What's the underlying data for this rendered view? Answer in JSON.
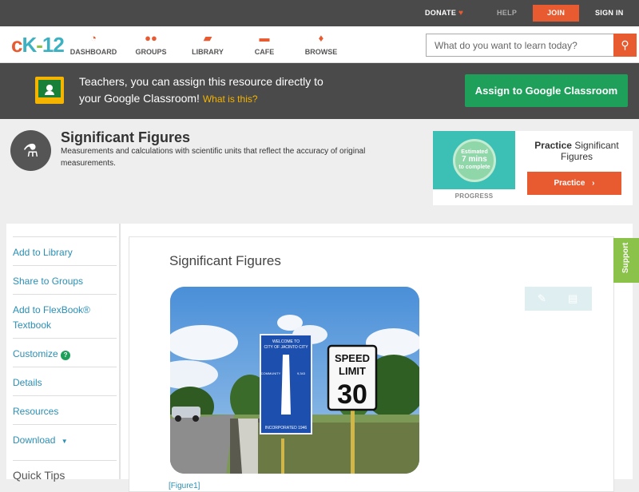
{
  "topbar": {
    "donate": "DONATE",
    "help": "HELP",
    "join": "JOIN",
    "signin": "SIGN IN"
  },
  "logo": {
    "text": "CK-12"
  },
  "nav": [
    {
      "label": "DASHBOARD",
      "icon": "dashboard-icon"
    },
    {
      "label": "GROUPS",
      "icon": "groups-icon"
    },
    {
      "label": "LIBRARY",
      "icon": "library-icon"
    },
    {
      "label": "CAFE",
      "icon": "cafe-icon"
    },
    {
      "label": "BROWSE",
      "icon": "browse-icon"
    }
  ],
  "search": {
    "placeholder": "What do you want to learn today?"
  },
  "classroom": {
    "line1": "Teachers, you can assign this resource directly to",
    "line2": "your Google Classroom!",
    "link": "What is this?",
    "button": "Assign to Google Classroom"
  },
  "concept": {
    "title": "Significant Figures",
    "description": "Measurements and calculations with scientific units that reflect the accuracy of original measurements."
  },
  "practice": {
    "estimate_line1": "Estimated",
    "estimate_line2": "7 mins",
    "estimate_line3": "to complete",
    "progress": "PROGRESS",
    "title_bold": "Practice",
    "title_rest": "Significant Figures",
    "button": "Practice"
  },
  "sidebar": {
    "items": [
      "Add to Library",
      "Share to Groups",
      "Add to FlexBook® Textbook",
      "Customize",
      "Details",
      "Resources",
      "Download"
    ],
    "quick_tips": "Quick Tips"
  },
  "main": {
    "title": "Significant Figures",
    "figure_link": "[Figure1]",
    "sign1": {
      "l1": "WELCOME TO",
      "l2": "CITY OF JACINTO CITY",
      "community": "A COMMUNITY WITH PRIDE",
      "population": "POPULATION 9,343",
      "incorporated": "INCORPORATED 1946"
    },
    "sign2": {
      "speed": "SPEED",
      "limit": "LIMIT",
      "value": "30"
    }
  },
  "support": {
    "label": "Support"
  },
  "colors": {
    "accent": "#e85b31",
    "green": "#1e9f5a",
    "link": "#2b8fb4",
    "dark": "#4a4a4a"
  }
}
